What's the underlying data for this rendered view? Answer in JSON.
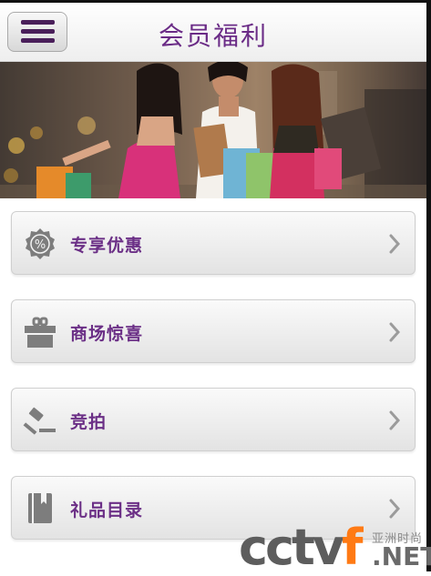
{
  "header": {
    "title": "会员福利",
    "menu_icon": "hamburger-menu-icon"
  },
  "banner": {
    "description_icon": "promo-banner-image"
  },
  "menu": {
    "items": [
      {
        "label": "专享优惠",
        "icon": "discount-badge-icon"
      },
      {
        "label": "商场惊喜",
        "icon": "gift-box-icon"
      },
      {
        "label": "竞拍",
        "icon": "auction-gavel-icon"
      },
      {
        "label": "礼品目录",
        "icon": "catalog-book-icon"
      }
    ],
    "chevron_icon": "chevron-right-icon"
  },
  "watermark": {
    "logo_text": "cctv",
    "logo_accent": "f",
    "subtitle": "亚洲时尚",
    "domain": ".NET"
  },
  "colors": {
    "title": "#6a2b86",
    "label": "#6b2f86",
    "menu_bars": "#4a1f5a",
    "icon_gray": "#7d7d7d",
    "watermark_accent": "#ff7a14"
  }
}
